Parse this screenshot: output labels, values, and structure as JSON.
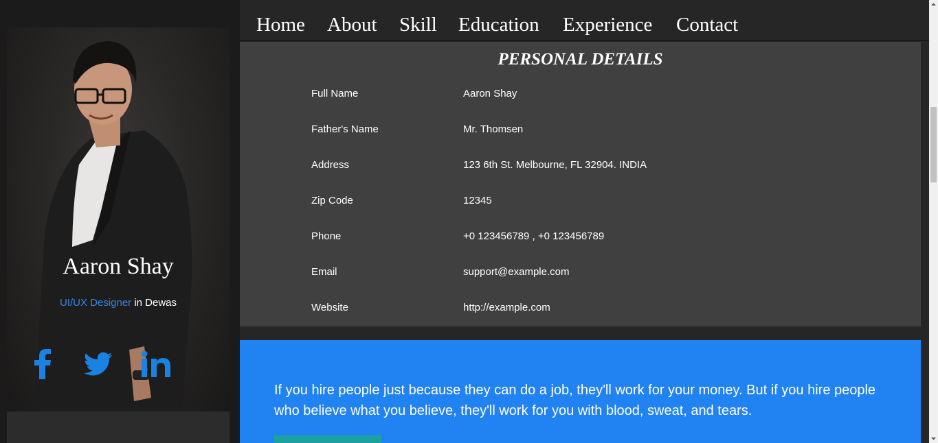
{
  "nav": {
    "items": [
      "Home",
      "About",
      "Skill",
      "Education",
      "Experience",
      "Contact"
    ]
  },
  "profile": {
    "name": "Aaron Shay",
    "role": "UI/UX Designer",
    "location_prefix": " in ",
    "location": "Dewas",
    "social_icons": [
      "facebook-icon",
      "twitter-icon",
      "linkedin-icon"
    ]
  },
  "details": {
    "title": "PERSONAL DETAILS",
    "rows": [
      {
        "label": "Full Name",
        "value": "Aaron Shay"
      },
      {
        "label": "Father's Name",
        "value": "Mr. Thomsen"
      },
      {
        "label": "Address",
        "value": "123 6th St. Melbourne, FL 32904. INDIA"
      },
      {
        "label": "Zip Code",
        "value": "12345"
      },
      {
        "label": "Phone",
        "value": "+0 123456789 , +0 123456789"
      },
      {
        "label": "Email",
        "value": "support@example.com"
      },
      {
        "label": "Website",
        "value": "http://example.com"
      }
    ]
  },
  "quote": {
    "text": "If you hire people just because they can do a job, they'll work for your money. But if you hire people who believe what you believe, they'll work for you with blood, sweat, and tears."
  },
  "colors": {
    "accent": "#2182f1",
    "social": "#1a82e2",
    "panel": "#404040",
    "background": "#262626"
  }
}
